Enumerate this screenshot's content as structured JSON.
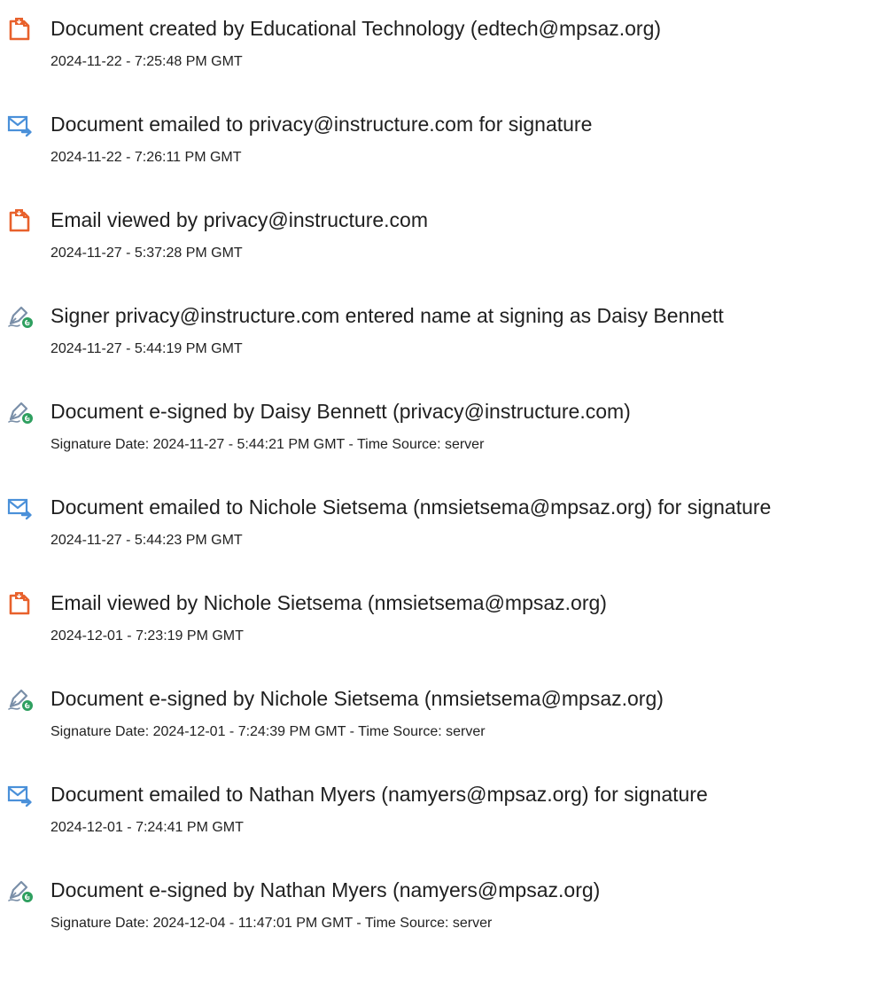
{
  "colors": {
    "pdf_icon": "#e8612c",
    "email_icon": "#4a90d9",
    "sign_pen": "#7a8fa8",
    "sign_badge": "#2e9f5f"
  },
  "events": [
    {
      "icon": "document-icon",
      "title": "Document created by Educational Technology (edtech@mpsaz.org)",
      "time": "2024-11-22 - 7:25:48 PM GMT"
    },
    {
      "icon": "email-icon",
      "title": "Document emailed to privacy@instructure.com for signature",
      "time": "2024-11-22 - 7:26:11 PM GMT"
    },
    {
      "icon": "document-icon",
      "title": "Email viewed by privacy@instructure.com",
      "time": "2024-11-27 - 5:37:28 PM GMT"
    },
    {
      "icon": "signature-pen-icon",
      "title": "Signer privacy@instructure.com entered name at signing as Daisy Bennett",
      "time": "2024-11-27 - 5:44:19 PM GMT"
    },
    {
      "icon": "signature-pen-icon",
      "title": "Document e-signed by Daisy Bennett (privacy@instructure.com)",
      "time": "Signature Date: 2024-11-27 - 5:44:21 PM GMT - Time Source: server"
    },
    {
      "icon": "email-icon",
      "title": "Document emailed to Nichole Sietsema (nmsietsema@mpsaz.org) for signature",
      "time": "2024-11-27 - 5:44:23 PM GMT"
    },
    {
      "icon": "document-icon",
      "title": "Email viewed by Nichole Sietsema (nmsietsema@mpsaz.org)",
      "time": "2024-12-01 - 7:23:19 PM GMT"
    },
    {
      "icon": "signature-pen-icon",
      "title": "Document e-signed by Nichole Sietsema (nmsietsema@mpsaz.org)",
      "time": "Signature Date: 2024-12-01 - 7:24:39 PM GMT - Time Source: server"
    },
    {
      "icon": "email-icon",
      "title": "Document emailed to Nathan Myers (namyers@mpsaz.org) for signature",
      "time": "2024-12-01 - 7:24:41 PM GMT"
    },
    {
      "icon": "signature-pen-icon",
      "title": "Document e-signed by Nathan Myers (namyers@mpsaz.org)",
      "time": "Signature Date: 2024-12-04 - 11:47:01 PM GMT - Time Source: server"
    }
  ]
}
